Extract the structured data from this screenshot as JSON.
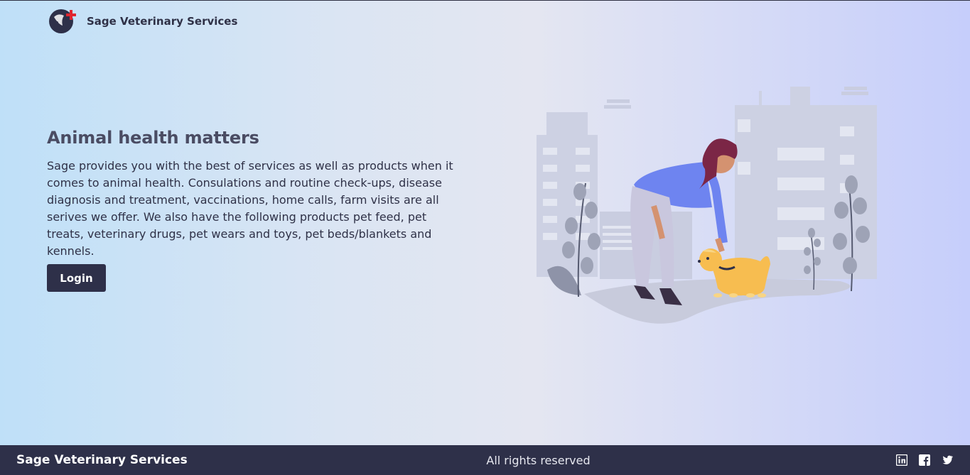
{
  "header": {
    "brand_name": "Sage Veterinary Services",
    "logo_icon": "paw-cross-logo-icon"
  },
  "hero": {
    "title": "Animal health matters",
    "description": "Sage provides you with the best of services as well as products when it comes to animal health. Consulations and routine check-ups, disease diagnosis and treatment, vaccinations, home calls, farm visits are all serives we offer. We also have the following products pet feed, pet treats, veterinary drugs, pet wears and toys, pet beds/blankets and kennels.",
    "login_label": "Login"
  },
  "illustration": {
    "icon": "woman-petting-dog-city-illustration"
  },
  "footer": {
    "brand_name": "Sage Veterinary Services",
    "rights": "All rights reserved",
    "social": [
      "linkedin-icon",
      "facebook-icon",
      "twitter-icon"
    ]
  },
  "colors": {
    "primary_dark": "#2e3049",
    "accent_red": "#e0262f",
    "dog_yellow": "#f7bd50",
    "shirt_blue": "#6e84f0",
    "hair_maroon": "#7b2646",
    "building_gray": "#c9cde0"
  }
}
